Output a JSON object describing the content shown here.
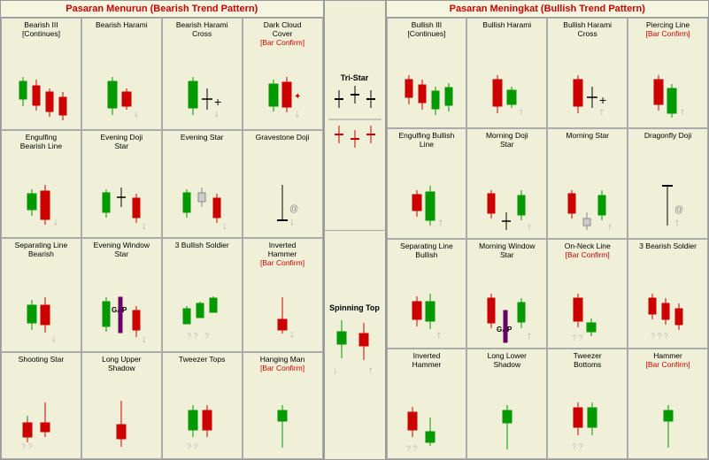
{
  "bearish": {
    "header": "Pasaran Menurun (Bearish Trend Pattern)",
    "patterns": [
      {
        "id": "bearish-iii",
        "label": "Bearish III\n[Continues]",
        "barConfirm": false
      },
      {
        "id": "bearish-harami",
        "label": "Bearish Harami",
        "barConfirm": false
      },
      {
        "id": "bearish-harami-cross",
        "label": "Bearish Harami\nCross",
        "barConfirm": false
      },
      {
        "id": "dark-cloud-cover",
        "label": "Dark Cloud\nCover",
        "barConfirm": true
      },
      {
        "id": "engulfing-bearish",
        "label": "Engulfing\nBearish Line",
        "barConfirm": false
      },
      {
        "id": "evening-doji-star",
        "label": "Evening Doji\nStar",
        "barConfirm": false
      },
      {
        "id": "evening-star",
        "label": "Evening Star",
        "barConfirm": false
      },
      {
        "id": "gravestone-doji",
        "label": "Gravestone Doji",
        "barConfirm": false
      },
      {
        "id": "separating-line-bearish",
        "label": "Separating Line\nBearish",
        "barConfirm": false
      },
      {
        "id": "evening-window-star",
        "label": "Evening Window\nStar",
        "barConfirm": false
      },
      {
        "id": "3-bullish-soldier",
        "label": "3 Bullish Soldier",
        "barConfirm": false
      },
      {
        "id": "inverted-hammer",
        "label": "Inverted\nHammer",
        "barConfirm": true
      },
      {
        "id": "shooting-star",
        "label": "Shooting Star",
        "barConfirm": false
      },
      {
        "id": "long-upper-shadow",
        "label": "Long Upper\nShadow",
        "barConfirm": false
      },
      {
        "id": "tweezer-tops",
        "label": "Tweezer Tops",
        "barConfirm": false
      },
      {
        "id": "hanging-man",
        "label": "Hanging Man",
        "barConfirm": true
      }
    ]
  },
  "middle": {
    "patterns": [
      {
        "id": "tri-star",
        "label": "Tri-Star"
      },
      {
        "id": "spinning-top",
        "label": "Spinning Top"
      }
    ]
  },
  "bullish": {
    "header": "Pasaran Meningkat (Bullish Trend Pattern)",
    "patterns": [
      {
        "id": "bullish-iii",
        "label": "Bullish III\n[Continues]",
        "barConfirm": false
      },
      {
        "id": "bullish-harami",
        "label": "Bullish Harami",
        "barConfirm": false
      },
      {
        "id": "bullish-harami-cross",
        "label": "Bullish Harami\nCross",
        "barConfirm": false
      },
      {
        "id": "piercing-line",
        "label": "Piercing Line",
        "barConfirm": true
      },
      {
        "id": "engulfing-bullish",
        "label": "Engulfing Bullish\nLine",
        "barConfirm": false
      },
      {
        "id": "morning-doji-star",
        "label": "Morning Doji\nStar",
        "barConfirm": false
      },
      {
        "id": "morning-star",
        "label": "Morning Star",
        "barConfirm": false
      },
      {
        "id": "dragonfly-doji",
        "label": "Dragonfly Doji",
        "barConfirm": false
      },
      {
        "id": "separating-line-bullish",
        "label": "Separating Line\nBullish",
        "barConfirm": false
      },
      {
        "id": "morning-window-star",
        "label": "Morning Window\nStar",
        "barConfirm": false
      },
      {
        "id": "on-neck-line",
        "label": "On-Neck Line",
        "barConfirm": true
      },
      {
        "id": "3-bearish-soldier",
        "label": "3 Bearish Soldier",
        "barConfirm": false
      },
      {
        "id": "inverted-hammer-b",
        "label": "Inverted\nHammer",
        "barConfirm": false
      },
      {
        "id": "long-lower-shadow",
        "label": "Long Lower\nShadow",
        "barConfirm": false
      },
      {
        "id": "tweezer-bottoms",
        "label": "Tweezer\nBottoms",
        "barConfirm": false
      },
      {
        "id": "hammer",
        "label": "Hammer",
        "barConfirm": true
      }
    ]
  }
}
